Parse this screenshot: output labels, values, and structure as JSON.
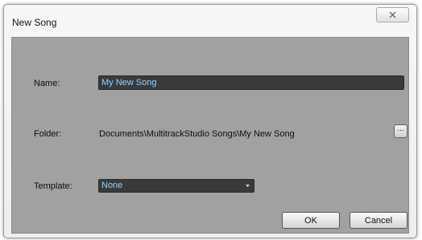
{
  "dialog": {
    "title": "New Song",
    "close_icon": "close-icon",
    "name": {
      "label": "Name:",
      "value": "My New Song"
    },
    "folder": {
      "label": "Folder:",
      "path": "Documents\\MultitrackStudio Songs\\My New Song",
      "browse_label": "..."
    },
    "template": {
      "label": "Template:",
      "selected": "None",
      "icon": "chevron-down-icon"
    },
    "buttons": {
      "ok": "OK",
      "cancel": "Cancel"
    }
  },
  "colors": {
    "client_bg": "#a1a1a1",
    "field_bg": "#3a3a3a",
    "field_text": "#8fd3ff"
  }
}
